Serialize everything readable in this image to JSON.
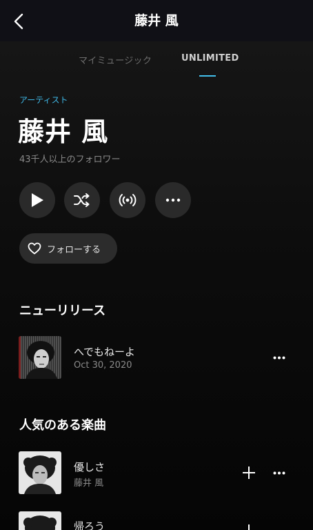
{
  "header": {
    "title": "藤井 風",
    "back_icon": "chevron-left-icon"
  },
  "tabs": [
    {
      "label": "マイミュージック",
      "active": false
    },
    {
      "label": "UNLIMITED",
      "active": true
    }
  ],
  "artist": {
    "kicker": "アーティスト",
    "name": "藤井 風",
    "followers": "43千人以上のフォロワー"
  },
  "actions": {
    "play_icon": "play-icon",
    "shuffle_icon": "shuffle-icon",
    "radio_icon": "radio-broadcast-icon",
    "more_icon": "more-horizontal-icon",
    "follow_label": "フォローする",
    "follow_icon": "heart-outline-icon"
  },
  "new_releases": {
    "title": "ニューリリース",
    "items": [
      {
        "title": "へでもねーよ",
        "subtitle": "Oct 30, 2020"
      }
    ]
  },
  "popular": {
    "title": "人気のある楽曲",
    "items": [
      {
        "title": "優しさ",
        "subtitle": "藤井 風"
      },
      {
        "title": "帰ろう",
        "subtitle": ""
      }
    ]
  },
  "colors": {
    "accent": "#43c0ec",
    "background": "#000000",
    "button": "#2a2a2a"
  }
}
